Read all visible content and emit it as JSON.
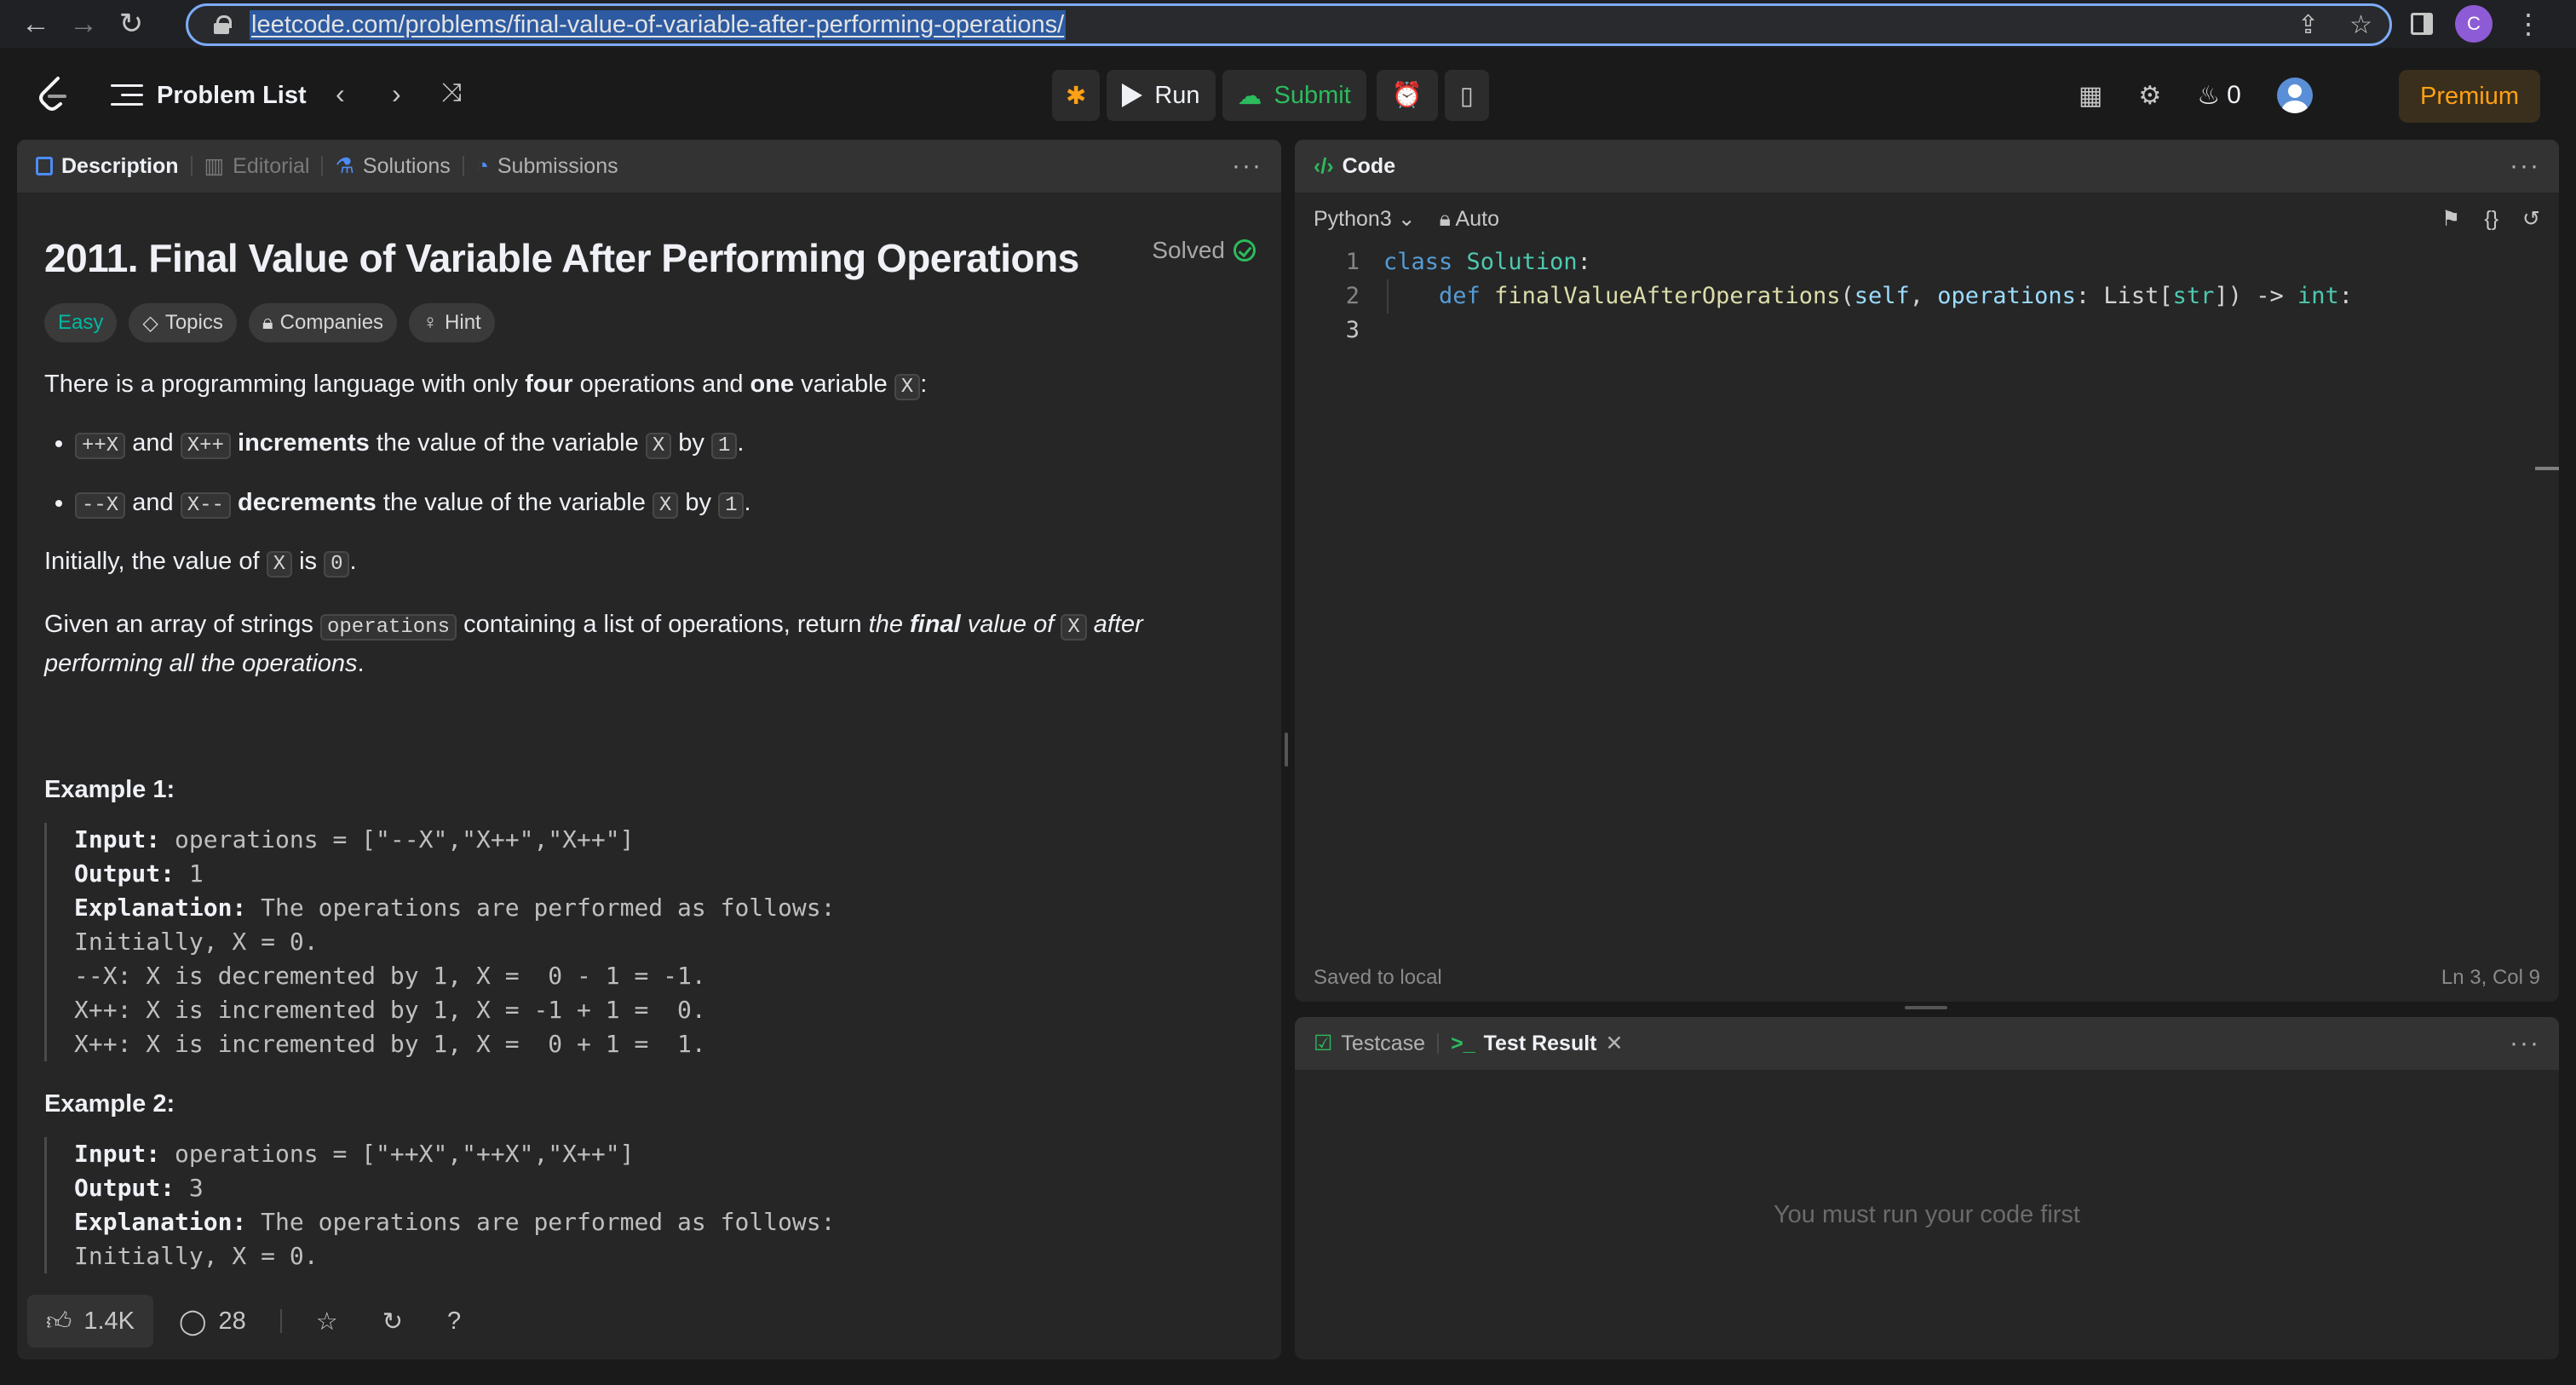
{
  "browser": {
    "url": "leetcode.com/problems/final-value-of-variable-after-performing-operations/",
    "profile_initial": "C"
  },
  "topbar": {
    "problem_list": "Problem List",
    "run": "Run",
    "submit": "Submit",
    "streak": "0",
    "premium": "Premium"
  },
  "description": {
    "tabs": [
      "Description",
      "Editorial",
      "Solutions",
      "Submissions"
    ],
    "title": "2011. Final Value of Variable After Performing Operations",
    "status": "Solved",
    "tags": [
      "Easy",
      "Topics",
      "Companies",
      "Hint"
    ],
    "intro": {
      "a": "There is a programming language with only ",
      "b": "four",
      "c": " operations and ",
      "d": "one",
      "e": " variable ",
      "x": "X",
      "f": ":"
    },
    "bullet1": {
      "c1": "++X",
      "and": "and",
      "c2": "X++",
      "bold": "increments",
      "rest": "the value of the variable",
      "x": "X",
      "by": "by",
      "one": "1",
      "end": "."
    },
    "bullet2": {
      "c1": "--X",
      "and": "and",
      "c2": "X--",
      "bold": "decrements",
      "rest": "the value of the variable",
      "x": "X",
      "by": "by",
      "one": "1",
      "end": "."
    },
    "initially": {
      "a": "Initially, the value of ",
      "x": "X",
      "b": " is ",
      "zero": "0",
      "c": "."
    },
    "given": {
      "a": "Given an array of strings ",
      "code": "operations",
      "b": " containing a list of operations, return ",
      "i1": "the ",
      "bi": "final",
      "i2": " value of ",
      "x": "X",
      "i3": " after performing all the operations",
      "c": "."
    },
    "example1": {
      "title": "Example 1:",
      "input_label": "Input:",
      "input": " operations = [\"--X\",\"X++\",\"X++\"]",
      "output_label": "Output:",
      "output": " 1",
      "expl_label": "Explanation:",
      "expl": " The operations are performed as follows:",
      "lines": [
        "Initially, X = 0.",
        "--X: X is decremented by 1, X =  0 - 1 = -1.",
        "X++: X is incremented by 1, X = -1 + 1 =  0.",
        "X++: X is incremented by 1, X =  0 + 1 =  1."
      ]
    },
    "example2": {
      "title": "Example 2:",
      "input_label": "Input:",
      "input": " operations = [\"++X\",\"++X\",\"X++\"]",
      "output_label": "Output:",
      "output": " 3",
      "expl_label": "Explanation:",
      "expl": " The operations are performed as follows:",
      "partial": "Initially, X = 0."
    },
    "footer": {
      "likes": "1.4K",
      "comments": "28"
    }
  },
  "code": {
    "tab": "Code",
    "language": "Python3",
    "mode": "Auto",
    "line_numbers": [
      "1",
      "2",
      "3"
    ],
    "line1": {
      "kw": "class",
      "name": "Solution",
      "colon": ":"
    },
    "line2": {
      "kw": "def",
      "fn": "finalValueAfterOperations",
      "p1": "(",
      "self": "self",
      "c1": ", ",
      "arg": "operations",
      "c2": ": List[",
      "t1": "str",
      "c3": "]) -> ",
      "t2": "int",
      "c4": ":"
    },
    "saved": "Saved to local",
    "cursor": "Ln 3, Col 9"
  },
  "result": {
    "tabs": [
      "Testcase",
      "Test Result"
    ],
    "message": "You must run your code first"
  }
}
